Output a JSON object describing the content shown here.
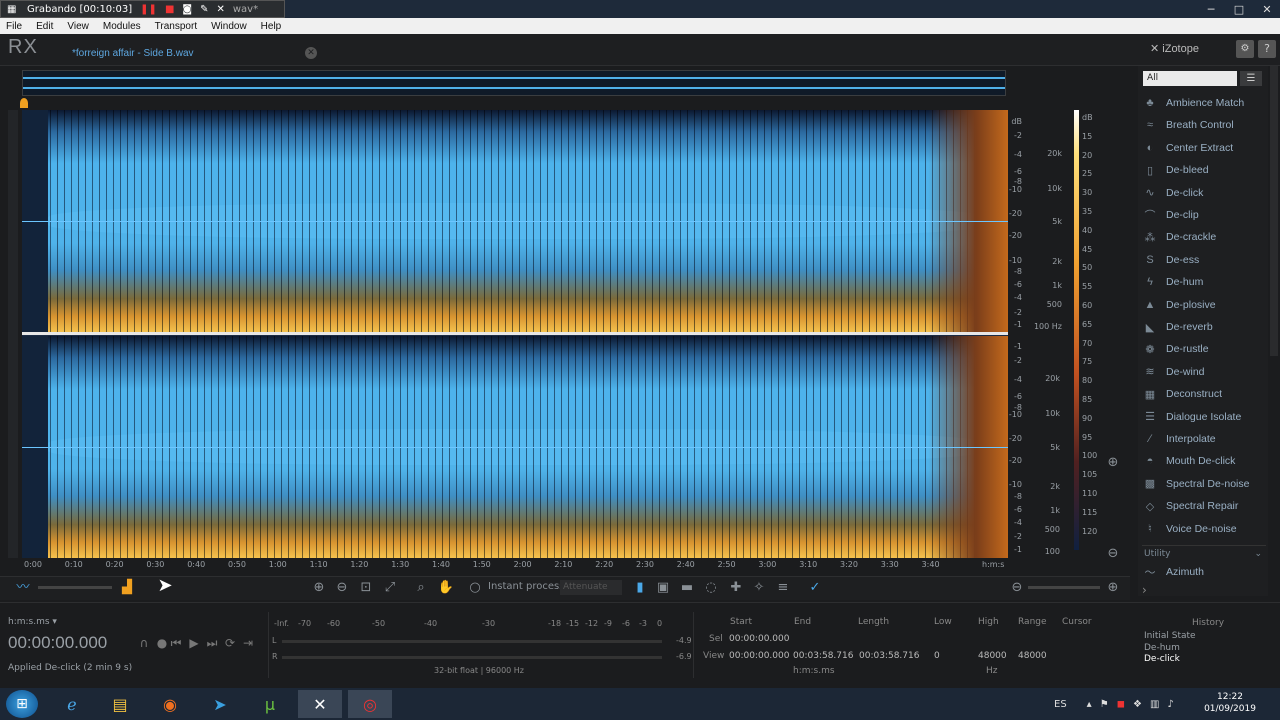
{
  "recorder": {
    "label": "Grabando [00:10:03]",
    "bg_title": "wav*"
  },
  "menu": [
    "File",
    "Edit",
    "View",
    "Modules",
    "Transport",
    "Window",
    "Help"
  ],
  "app": {
    "logo": "RX",
    "brand": "iZotope",
    "file_tab": "*forreign affair - Side B.wav"
  },
  "db_scale_top": [
    "dB",
    "-2",
    "-4",
    "-6",
    "-8",
    "-10",
    "-20",
    "-20",
    "-10",
    "-8",
    "-6",
    "-4",
    "-2",
    "-1"
  ],
  "db_scale_bottom": [
    "-1",
    "-2",
    "-4",
    "-6",
    "-8",
    "-10",
    "-20",
    "-20",
    "-10",
    "-8",
    "-6",
    "-4",
    "-2",
    "-1"
  ],
  "hz_scale_top": [
    "20k",
    "10k",
    "5k",
    "2k",
    "1k",
    "500",
    "100 Hz"
  ],
  "hz_scale_bottom": [
    "20k",
    "10k",
    "5k",
    "2k",
    "1k",
    "500",
    "100"
  ],
  "color_scale": [
    "dB",
    "15",
    "20",
    "25",
    "30",
    "35",
    "40",
    "45",
    "50",
    "55",
    "60",
    "65",
    "70",
    "75",
    "80",
    "85",
    "90",
    "95",
    "100",
    "105",
    "110",
    "115",
    "120"
  ],
  "timeline": [
    "0:00",
    "0:10",
    "0:20",
    "0:30",
    "0:40",
    "0:50",
    "1:00",
    "1:10",
    "1:20",
    "1:30",
    "1:40",
    "1:50",
    "2:00",
    "2:10",
    "2:20",
    "2:30",
    "2:40",
    "2:50",
    "3:00",
    "3:10",
    "3:20",
    "3:30",
    "3:40",
    "h:m:s"
  ],
  "toolbar": {
    "instant_process": "Instant process",
    "attenuate": "Attenuate"
  },
  "modules": {
    "filter": "All",
    "items": [
      {
        "label": "Ambience Match",
        "icon": "ambience-match-icon"
      },
      {
        "label": "Breath Control",
        "icon": "breath-control-icon"
      },
      {
        "label": "Center Extract",
        "icon": "center-extract-icon"
      },
      {
        "label": "De-bleed",
        "icon": "de-bleed-icon"
      },
      {
        "label": "De-click",
        "icon": "de-click-icon"
      },
      {
        "label": "De-clip",
        "icon": "de-clip-icon"
      },
      {
        "label": "De-crackle",
        "icon": "de-crackle-icon"
      },
      {
        "label": "De-ess",
        "icon": "de-ess-icon"
      },
      {
        "label": "De-hum",
        "icon": "de-hum-icon"
      },
      {
        "label": "De-plosive",
        "icon": "de-plosive-icon"
      },
      {
        "label": "De-reverb",
        "icon": "de-reverb-icon"
      },
      {
        "label": "De-rustle",
        "icon": "de-rustle-icon"
      },
      {
        "label": "De-wind",
        "icon": "de-wind-icon"
      },
      {
        "label": "Deconstruct",
        "icon": "deconstruct-icon"
      },
      {
        "label": "Dialogue Isolate",
        "icon": "dialogue-isolate-icon"
      },
      {
        "label": "Interpolate",
        "icon": "interpolate-icon"
      },
      {
        "label": "Mouth De-click",
        "icon": "mouth-de-click-icon"
      },
      {
        "label": "Spectral De-noise",
        "icon": "spectral-de-noise-icon"
      },
      {
        "label": "Spectral Repair",
        "icon": "spectral-repair-icon"
      },
      {
        "label": "Voice De-noise",
        "icon": "voice-de-noise-icon"
      }
    ],
    "group": "Utility",
    "partial": "Azimuth"
  },
  "transport": {
    "time_format": "h:m:s.ms",
    "time": "00:00:00.000",
    "status": "Applied De-click (2 min 9 s)"
  },
  "meter": {
    "scale": [
      "-Inf.",
      "-70",
      "-60",
      "-50",
      "-40",
      "-30",
      "-18",
      "-15",
      "-12",
      "-9",
      "-6",
      "-3",
      "0"
    ],
    "l_label": "L",
    "r_label": "R",
    "l_value": "-4.9",
    "r_value": "-6.9",
    "format": "32-bit float | 96000 Hz"
  },
  "selection": {
    "headers": [
      "Start",
      "End",
      "Length",
      "Low",
      "High",
      "Range",
      "Cursor"
    ],
    "sel_label": "Sel",
    "view_label": "View",
    "sel_start": "00:00:00.000",
    "view_start": "00:00:00.000",
    "view_end": "00:03:58.716",
    "view_length": "00:03:58.716",
    "low": "0",
    "high": "48000",
    "range": "48000",
    "time_unit": "h:m:s.ms",
    "freq_unit": "Hz"
  },
  "history": {
    "title": "History",
    "items": [
      "Initial State",
      "De-hum",
      "De-click"
    ]
  },
  "taskbar": {
    "lang": "ES",
    "time": "12:22",
    "date": "01/09/2019"
  }
}
